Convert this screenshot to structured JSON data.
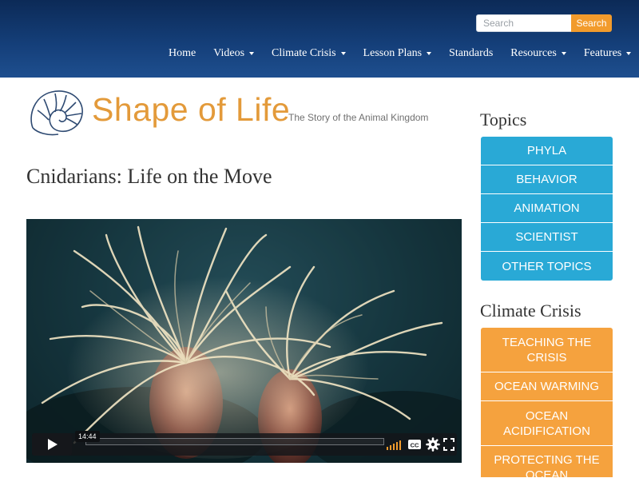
{
  "search": {
    "placeholder": "Search",
    "button_label": "Search"
  },
  "nav": {
    "items": [
      {
        "label": "Home",
        "dropdown": false
      },
      {
        "label": "Videos",
        "dropdown": true
      },
      {
        "label": "Climate Crisis",
        "dropdown": true
      },
      {
        "label": "Lesson Plans",
        "dropdown": true
      },
      {
        "label": "Standards",
        "dropdown": false
      },
      {
        "label": "Resources",
        "dropdown": true
      },
      {
        "label": "Features",
        "dropdown": true
      }
    ]
  },
  "logo": {
    "wordmark": "Shape of Life",
    "tagline": "The Story of the Animal Kingdom"
  },
  "page": {
    "title": "Cnidarians: Life on the Move"
  },
  "video": {
    "duration": "14:44"
  },
  "sidebar": {
    "topics_heading": "Topics",
    "topics": [
      "PHYLA",
      "BEHAVIOR",
      "ANIMATION",
      "SCIENTIST",
      "OTHER TOPICS"
    ],
    "climate_heading": "Climate Crisis",
    "climate": [
      "TEACHING THE CRISIS",
      "OCEAN WARMING",
      "OCEAN ACIDIFICATION",
      "PROTECTING THE OCEAN"
    ]
  },
  "colors": {
    "header_top": "#0c2a57",
    "header_bottom": "#1e4f8f",
    "accent_orange": "#f29b2c",
    "topic_blue": "#29a9d6",
    "climate_orange": "#f5a23e",
    "logo_orange": "#e39a3a"
  }
}
